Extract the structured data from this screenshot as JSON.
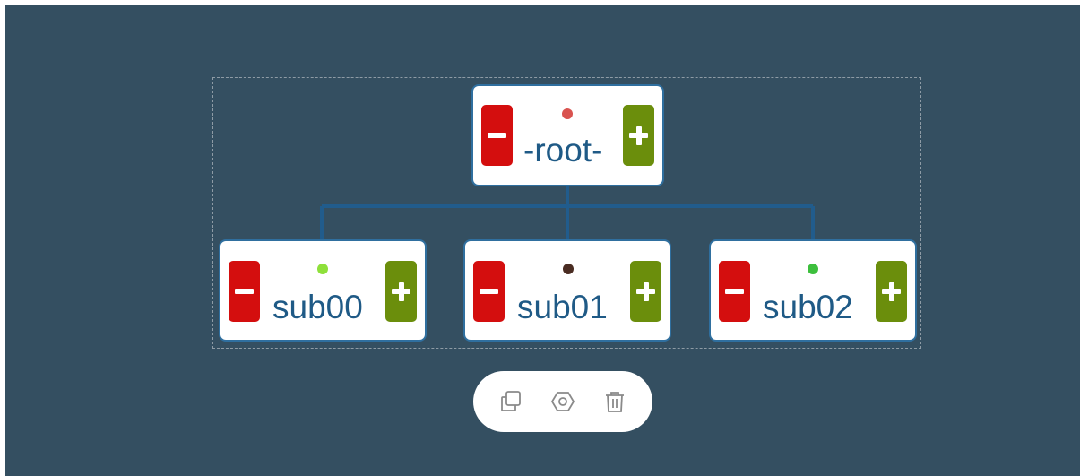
{
  "nodes": {
    "root": {
      "label": "-root-",
      "status_color": "#d9534f"
    },
    "sub00": {
      "label": "sub00",
      "status_color": "#8ee03a"
    },
    "sub01": {
      "label": "sub01",
      "status_color": "#4a2c22"
    },
    "sub02": {
      "label": "sub02",
      "status_color": "#3dbf3d"
    }
  },
  "colors": {
    "background": "#344f61",
    "connector": "#215c8c",
    "collapse_button": "#d40e0e",
    "expand_button": "#6b8e0c",
    "label_text": "#1f5a86"
  },
  "node_buttons": {
    "collapse_icon": "minus-icon",
    "expand_icon": "plus-icon"
  },
  "toolbar": {
    "icons": [
      "copy-icon",
      "settings-icon",
      "trash-icon"
    ]
  }
}
